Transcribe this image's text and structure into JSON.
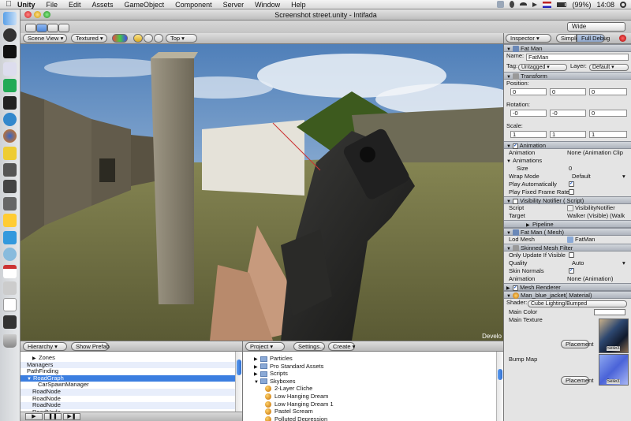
{
  "menubar": {
    "app_name": "Unity",
    "items": [
      "File",
      "Edit",
      "Assets",
      "GameObject",
      "Component",
      "Server",
      "Window",
      "Help"
    ],
    "battery": "(99%)",
    "clock": "14:08"
  },
  "window": {
    "title": "Screenshot street.unity - Intifada",
    "layout_select": "Wide"
  },
  "scene_view": {
    "tab_label": "Scene View",
    "render_mode": "Textured",
    "view_direction": "Top",
    "overlay_text": "Develo"
  },
  "inspector": {
    "tab_label": "Inspector",
    "simple_label": "Simple",
    "full_debug_label": "Full Debug",
    "object_header": "Fat Man",
    "name_label": "Name:",
    "name_value": "FatMan",
    "tag_label": "Tag:",
    "tag_value": "Untagged",
    "layer_label": "Layer:",
    "layer_value": "Default",
    "transform": {
      "header": "Transform",
      "position_label": "Position:",
      "position": [
        "0",
        "0",
        "0"
      ],
      "rotation_label": "Rotation:",
      "rotation": [
        "-0",
        "-0",
        "0"
      ],
      "scale_label": "Scale:",
      "scale": [
        "1",
        "1",
        "1"
      ]
    },
    "animation": {
      "header": "Animation",
      "animation_label": "Animation",
      "animation_value": "None (Animation Clip",
      "animations_label": "Animations",
      "size_label": "Size",
      "size_value": "0",
      "wrap_mode_label": "Wrap Mode",
      "wrap_mode_value": "Default",
      "play_auto_label": "Play Automatically",
      "play_fixed_label": "Play Fixed Frame Rate"
    },
    "visibility_notifier": {
      "header": "Visibility Notifier ( Script)",
      "script_label": "Script",
      "script_value": "VisibilityNotifier",
      "target_label": "Target",
      "target_value": "Walker (Visible) (Walk",
      "pipeline_label": "Pipeline"
    },
    "lod_mesh": {
      "header": "Fat Man ( Mesh)",
      "label": "Lod Mesh",
      "value": "FatMan"
    },
    "skinned_mesh": {
      "header": "Skinned Mesh Filter",
      "only_update_label": "Only Update If Visible",
      "quality_label": "Quality",
      "quality_value": "Auto",
      "skin_normals_label": "Skin Normals",
      "animation_label": "Animation",
      "animation_value": "None (Animation)"
    },
    "mesh_renderer": {
      "header": "Mesh Renderer"
    },
    "material": {
      "header": "Man_blue_jacket( Material)",
      "shader_label": "Shader:",
      "shader_value": "Cube Lighting/Bumped",
      "main_color_label": "Main Color",
      "main_texture_label": "Main Texture",
      "bump_map_label": "Bump Map",
      "placement_label": "Placement",
      "select_label": "Select"
    }
  },
  "hierarchy": {
    "tab_label": "Hierarchy",
    "show_prefab_label": "Show Prefab",
    "rows": [
      {
        "label": "Zones",
        "indent": 1,
        "expander": true,
        "selected": false
      },
      {
        "label": "Managers",
        "indent": 0,
        "expander": false,
        "selected": false
      },
      {
        "label": "PathFinding",
        "indent": 0,
        "expander": false,
        "selected": false
      },
      {
        "label": "RoadGraph",
        "indent": 0,
        "expander": true,
        "selected": true
      },
      {
        "label": "CarSpawnManager",
        "indent": 2,
        "expander": false,
        "selected": false
      },
      {
        "label": "RoadNode",
        "indent": 1,
        "expander": false,
        "selected": false
      },
      {
        "label": "RoadNode",
        "indent": 1,
        "expander": false,
        "selected": false
      },
      {
        "label": "RoadNode",
        "indent": 1,
        "expander": false,
        "selected": false
      },
      {
        "label": "RoadNode",
        "indent": 1,
        "expander": false,
        "selected": false
      }
    ]
  },
  "project": {
    "tab_label": "Project",
    "settings_label": "Settings...",
    "create_label": "Create",
    "rows": [
      {
        "label": "Particles",
        "type": "folder",
        "indent": 0
      },
      {
        "label": "Pro Standard Assets",
        "type": "folder",
        "indent": 0
      },
      {
        "label": "Scripts",
        "type": "folder",
        "indent": 0
      },
      {
        "label": "Skyboxes",
        "type": "folder-open",
        "indent": 0
      },
      {
        "label": "2-Layer Cliche",
        "type": "material",
        "indent": 1
      },
      {
        "label": "Low Hanging Dream",
        "type": "material",
        "indent": 1
      },
      {
        "label": "Low Hanging Dream 1",
        "type": "material",
        "indent": 1
      },
      {
        "label": "Pastel Scream",
        "type": "material",
        "indent": 1
      },
      {
        "label": "Polluted Depression",
        "type": "material",
        "indent": 1
      }
    ]
  },
  "play_controls": [
    "▶",
    "❚❚",
    "▶❚"
  ]
}
